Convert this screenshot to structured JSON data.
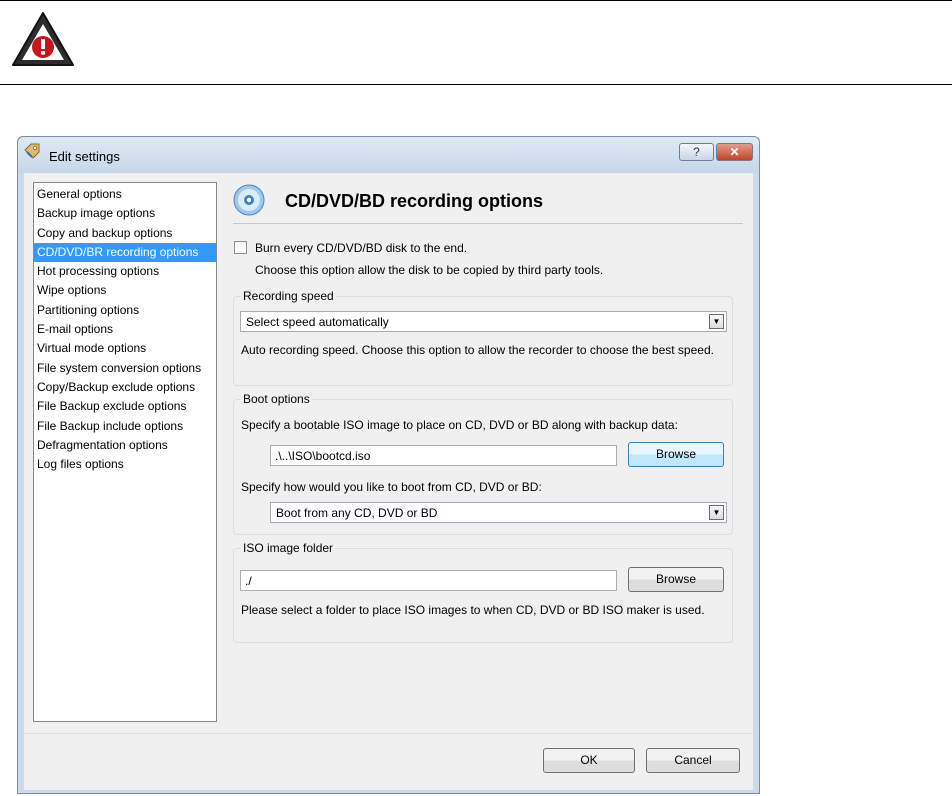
{
  "doc": {
    "link_part1": "",
    "link_part2": ""
  },
  "dialog": {
    "title": "Edit settings",
    "help_label": "?",
    "close_label": "✕",
    "nav_items": [
      "General options",
      "Backup image options",
      "Copy and backup options",
      "CD/DVD/BR recording options",
      "Hot processing options",
      "Wipe options",
      "Partitioning options",
      "E-mail options",
      "Virtual mode options",
      "File system conversion options",
      "Copy/Backup exclude options",
      "File Backup exclude options",
      "File Backup include options",
      "Defragmentation options",
      "Log files options"
    ],
    "selected_nav_index": 3,
    "page_title": "CD/DVD/BD recording options",
    "burn_checkbox_label": "Burn every CD/DVD/BD disk to the end.",
    "burn_checkbox_checked": false,
    "burn_hint": "Choose this option allow the disk to be copied by third party tools.",
    "recording_speed": {
      "label": "Recording speed",
      "selected": "Select speed automatically",
      "hint": "Auto recording speed. Choose this option to allow the recorder to choose the best speed."
    },
    "boot_options": {
      "label": "Boot options",
      "iso_prompt": "Specify a bootable ISO image to place on CD, DVD or BD along with backup data:",
      "iso_path": ".\\..\\ISO\\bootcd.iso",
      "browse_label": "Browse",
      "boot_prompt": "Specify how would you like to boot from CD, DVD or BD:",
      "boot_selected": "Boot from any CD, DVD or BD"
    },
    "iso_folder": {
      "label": "ISO image folder",
      "path": "./",
      "browse_label": "Browse",
      "hint": "Please select a folder to place ISO images to when CD, DVD or BD ISO maker is used."
    },
    "ok_label": "OK",
    "cancel_label": "Cancel"
  },
  "colors": {
    "selection": "#3399ff",
    "link": "#0000ee",
    "warning_red": "#c4161c"
  }
}
